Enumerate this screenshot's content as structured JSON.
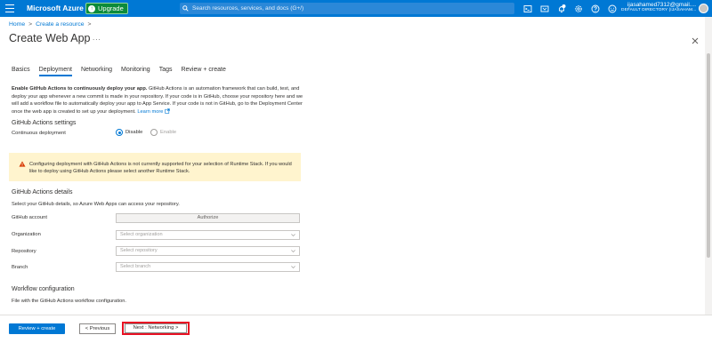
{
  "topbar": {
    "brand": "Microsoft Azure",
    "upgrade_label": "Upgrade",
    "search_placeholder": "Search resources, services, and docs (G+/)",
    "user_email": "ijasahamed7312@gmail....",
    "user_directory": "DEFAULT DIRECTORY (IJASAHAM...",
    "icons": [
      "cloud-shell-icon",
      "directory-filter-icon",
      "notifications-icon",
      "settings-icon",
      "help-icon",
      "feedback-icon"
    ],
    "notification_count": "1"
  },
  "breadcrumb": {
    "home": "Home",
    "sep": ">",
    "create_resource": "Create a resource",
    "sep2": ">"
  },
  "page": {
    "title": "Create Web App",
    "more": "..."
  },
  "tabs": [
    {
      "label": "Basics"
    },
    {
      "label": "Deployment",
      "active": true
    },
    {
      "label": "Networking"
    },
    {
      "label": "Monitoring"
    },
    {
      "label": "Tags"
    },
    {
      "label": "Review + create"
    }
  ],
  "intro": {
    "bold": "Enable GitHub Actions to continuously deploy your app.",
    "text": " GitHub Actions is an automation framework that can build, test, and deploy your app whenever a new commit is made in your repository. If your code is in GitHub, choose your repository here and we will add a workflow file to automatically deploy your app to App Service. If your code is not in GitHub, go to the Deployment Center once the web app is created to set up your deployment. ",
    "learn_more": "Learn more"
  },
  "github_settings": {
    "heading": "GitHub Actions settings",
    "continuous_label": "Continuous deployment",
    "disable_label": "Disable",
    "enable_label": "Enable",
    "selected": "Disable"
  },
  "warning": {
    "text": "Configuring deployment with GitHub Actions is not currently supported for your selection of Runtime Stack. If you would like to deploy using GitHub Actions please select another Runtime Stack."
  },
  "github_details": {
    "heading": "GitHub Actions details",
    "desc": "Select your GitHub details, so Azure Web Apps can access your repository.",
    "account_label": "GitHub account",
    "authorize_label": "Authorize",
    "org_label": "Organization",
    "org_placeholder": "Select organization",
    "repo_label": "Repository",
    "repo_placeholder": "Select repository",
    "branch_label": "Branch",
    "branch_placeholder": "Select branch"
  },
  "workflow": {
    "heading": "Workflow configuration",
    "desc": "File with the GitHub Actions workflow configuration."
  },
  "footer": {
    "review_create": "Review + create",
    "previous": "< Previous",
    "next": "Next : Networking >"
  },
  "colors": {
    "azure_blue": "#0078d4",
    "warning_bg": "#fff4ce",
    "highlight_red": "#e81123"
  }
}
